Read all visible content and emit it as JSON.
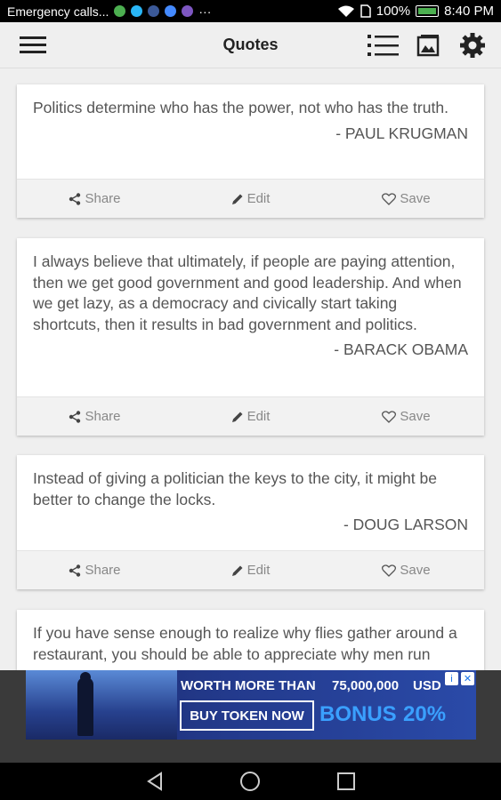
{
  "status_bar": {
    "carrier": "Emergency calls...",
    "dots": "···",
    "battery_text": "100%",
    "time": "8:40 PM",
    "notification_colors": [
      "#4caf50",
      "#29b6f6",
      "#3b5998",
      "#448aff",
      "#7e57c2"
    ]
  },
  "app_bar": {
    "title": "Quotes",
    "menu_icon": "menu-icon",
    "list_icon": "list-icon",
    "image_icon": "image-icon",
    "settings_icon": "gear-icon"
  },
  "actions": {
    "share": "Share",
    "edit": "Edit",
    "save": "Save"
  },
  "quotes": [
    {
      "text": "Politics determine who has the power, not who has the truth.",
      "author": "- PAUL KRUGMAN"
    },
    {
      "text": "I always believe that ultimately, if people are paying attention, then we get good government and good leadership. And when we get lazy, as a democracy and civically start taking shortcuts, then it results in bad government and politics.",
      "author": "- BARACK OBAMA"
    },
    {
      "text": "Instead of giving a politician the keys to the city, it might be better to change the locks.",
      "author": "- DOUG LARSON"
    },
    {
      "text": "If you have sense enough to realize why flies gather around a restaurant, you should be able to appreciate why men run",
      "author": ""
    }
  ],
  "ad": {
    "headline": "WORTH MORE THAN",
    "amount": "75,000,000",
    "currency": "USD",
    "button": "BUY TOKEN NOW",
    "bonus_label": "BONUS",
    "bonus_value": "20%",
    "info_glyph": "i",
    "close_glyph": "✕"
  },
  "colors": {
    "background": "#efefef",
    "card": "#ffffff",
    "action_bar": "#f2f2f2",
    "text": "#555555",
    "ad_accent": "#3aa0ff"
  }
}
